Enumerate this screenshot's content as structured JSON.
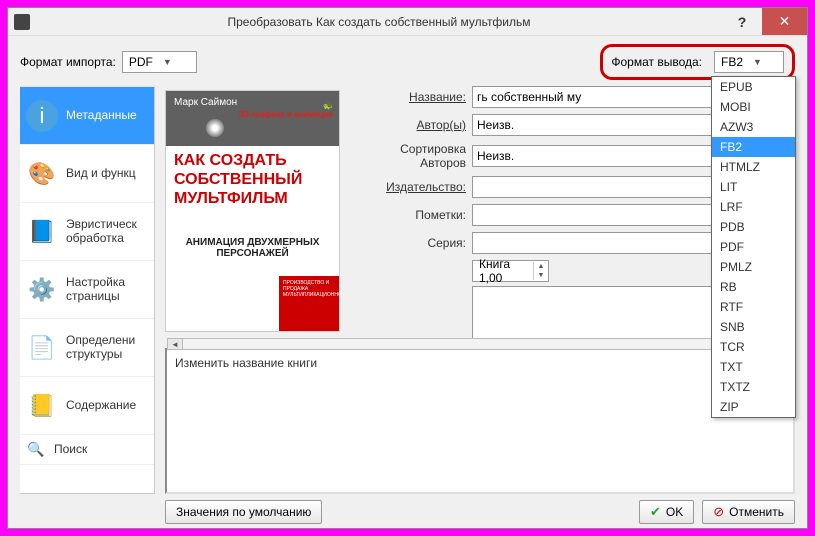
{
  "titlebar": {
    "title": "Преобразовать Как создать собственный мультфильм"
  },
  "toprow": {
    "import_label": "Формат импорта:",
    "import_value": "PDF",
    "output_label": "Формат вывода:",
    "output_value": "FB2"
  },
  "sidebar": {
    "items": [
      {
        "label": "Метаданные",
        "active": true
      },
      {
        "label": "Вид и функц"
      },
      {
        "label": "Эвристическ обработка"
      },
      {
        "label": "Настройка страницы"
      },
      {
        "label": "Определени структуры"
      },
      {
        "label": "Содержание"
      },
      {
        "label": "Поиск"
      }
    ]
  },
  "preview": {
    "author": "Марк Саймон",
    "badge": "3D-графика и анимация",
    "title": "КАК СОЗДАТЬ СОБСТВЕННЫЙ МУЛЬТФИЛЬМ",
    "subtitle": "АНИМАЦИЯ ДВУХМЕРНЫХ ПЕРСОНАЖЕЙ",
    "redbox": "ПРОИЗВОДСТВО И ПРОДАЖА МУЛЬТИПЛИКАЦИОННОГО"
  },
  "fields": {
    "name_label": "Название:",
    "name_value": "гь собственный му",
    "author_label": "Автор(ы)",
    "author_value": "Неизв.",
    "authorsort_label": "Сортировка Авторов",
    "authorsort_value": "Неизв.",
    "publisher_label": "Издательство:",
    "publisher_value": "",
    "tags_label": "Пометки:",
    "tags_value": "",
    "series_label": "Серия:",
    "series_value": "",
    "spin_value": "Книга 1,00"
  },
  "lower": {
    "text": "Изменить название книги"
  },
  "dropdown_options": [
    "EPUB",
    "MOBI",
    "AZW3",
    "FB2",
    "HTMLZ",
    "LIT",
    "LRF",
    "PDB",
    "PDF",
    "PMLZ",
    "RB",
    "RTF",
    "SNB",
    "TCR",
    "TXT",
    "TXTZ",
    "ZIP"
  ],
  "dropdown_selected": "FB2",
  "bottombar": {
    "defaults": "Значения по умолчанию",
    "ok": "OK",
    "cancel": "Отменить"
  }
}
